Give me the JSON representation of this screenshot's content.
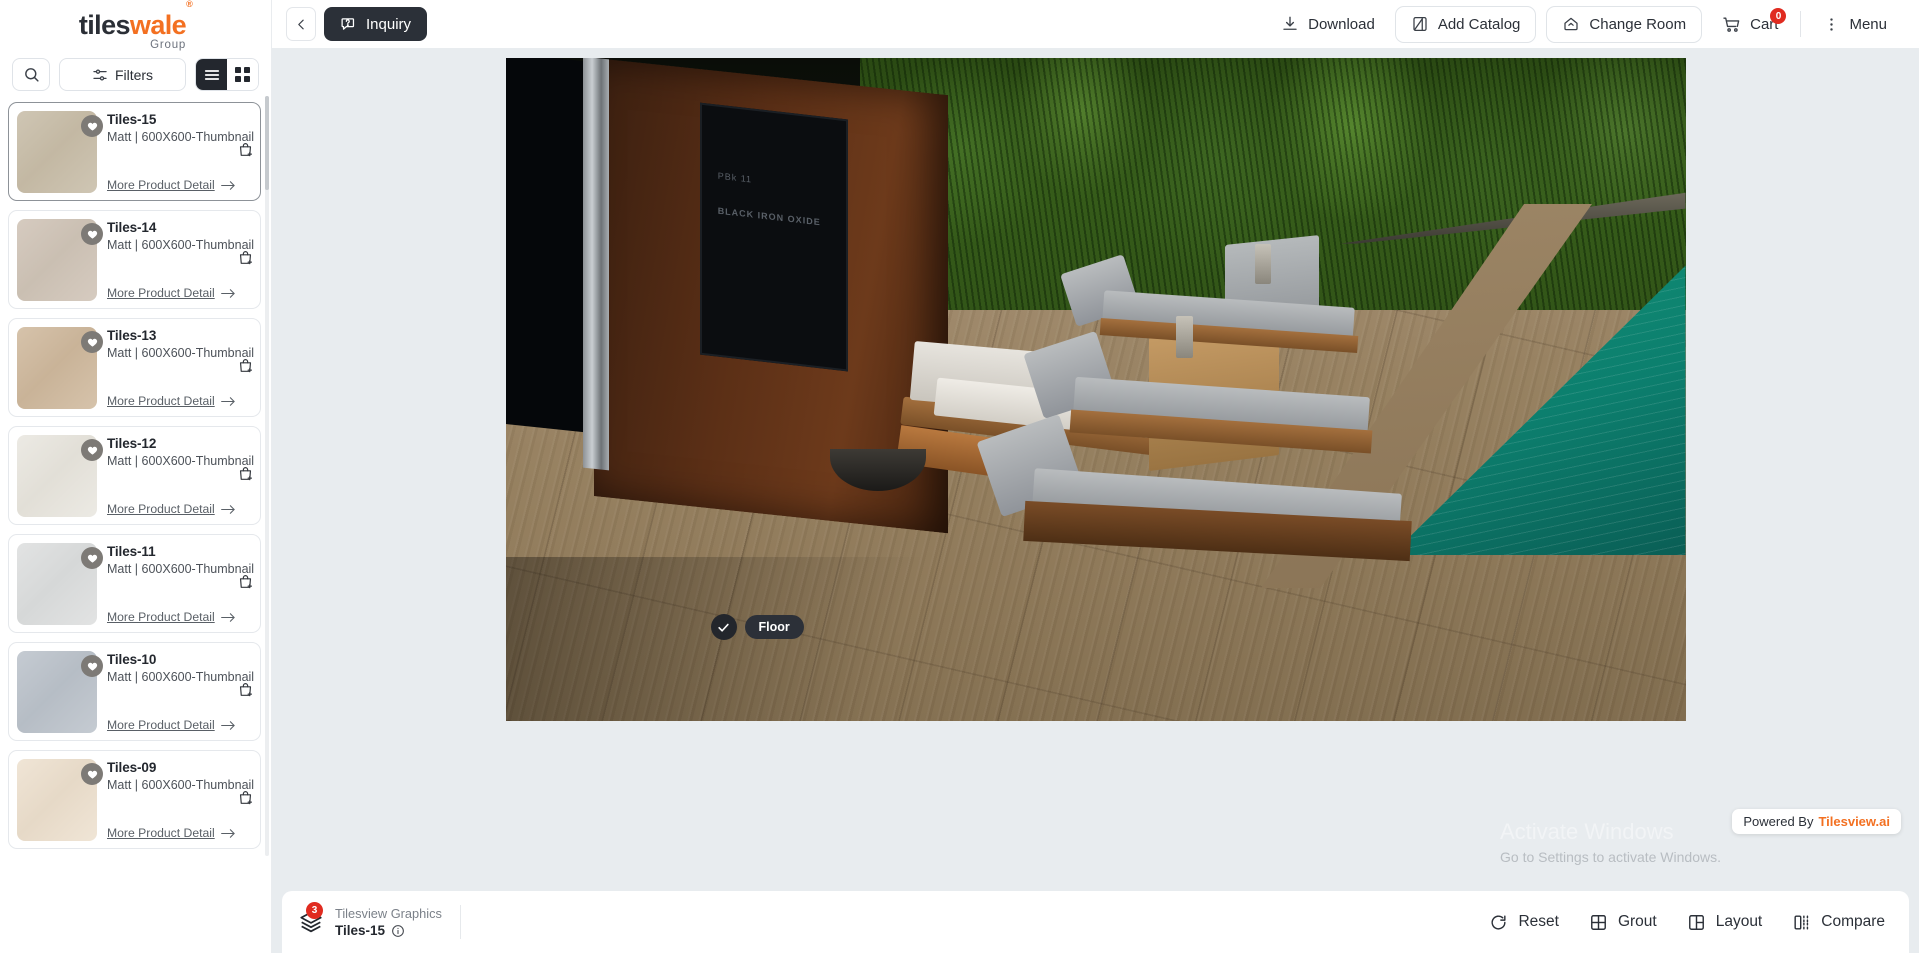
{
  "brand": {
    "name_part1": "tiles",
    "name_part2": "wale",
    "registered": "®",
    "subtitle": "Group"
  },
  "sidebar": {
    "search_icon": "search-icon",
    "filters_label": "Filters",
    "view_list_icon": "list-view-icon",
    "view_grid_icon": "grid-view-icon",
    "more_detail_label": "More Product Detail",
    "tiles": [
      {
        "name": "Tiles-15",
        "meta": "Matt | 600X600-Thumbnail",
        "color": "#cfc6b4",
        "color2": "#c3b8a3",
        "selected": true
      },
      {
        "name": "Tiles-14",
        "meta": "Matt | 600X600-Thumbnail",
        "color": "#d6cbc0",
        "color2": "#cabfb2",
        "selected": false
      },
      {
        "name": "Tiles-13",
        "meta": "Matt | 600X600-Thumbnail",
        "color": "#d6c3ab",
        "color2": "#c9b398",
        "selected": false
      },
      {
        "name": "Tiles-12",
        "meta": "Matt | 600X600-Thumbnail",
        "color": "#eceae4",
        "color2": "#e2dfd7",
        "selected": false
      },
      {
        "name": "Tiles-11",
        "meta": "Matt | 600X600-Thumbnail",
        "color": "#e2e3e3",
        "color2": "#d6d8d8",
        "selected": false
      },
      {
        "name": "Tiles-10",
        "meta": "Matt | 600X600-Thumbnail",
        "color": "#c5cbd2",
        "color2": "#b6bdc5",
        "selected": false
      },
      {
        "name": "Tiles-09",
        "meta": "Matt | 600X600-Thumbnail",
        "color": "#f0e5d6",
        "color2": "#e6d9c7",
        "selected": false
      }
    ]
  },
  "topbar": {
    "back_icon": "chevron-left-icon",
    "inquiry_label": "Inquiry",
    "inquiry_icon": "inquiry-chat-icon",
    "download_label": "Download",
    "download_icon": "download-icon",
    "add_catalog_label": "Add Catalog",
    "add_catalog_icon": "catalog-icon",
    "change_room_label": "Change Room",
    "change_room_icon": "home-icon",
    "cart_label": "Cart",
    "cart_icon": "cart-icon",
    "cart_count": "0",
    "menu_label": "Menu",
    "menu_icon": "more-vertical-icon"
  },
  "canvas": {
    "scene_wall_text_line1": "PBk 11",
    "scene_wall_text_line2": "BLACK IRON OXIDE",
    "surface_chip_label": "Floor",
    "surface_chip_check": "check-icon",
    "watermark_prefix": "Powered By",
    "watermark_brand": "Tilesview.ai",
    "windows_activate_line1": "Activate Windows",
    "windows_activate_line2": "Go to Settings to activate Windows."
  },
  "bottombar": {
    "layers_icon": "layers-icon",
    "layers_count": "3",
    "layers_title": "Tilesview Graphics",
    "selected_tile": "Tiles-15",
    "info_icon": "info-icon",
    "actions": [
      {
        "label": "Reset",
        "icon": "reset-icon"
      },
      {
        "label": "Grout",
        "icon": "grout-icon"
      },
      {
        "label": "Layout",
        "icon": "layout-icon"
      },
      {
        "label": "Compare",
        "icon": "compare-icon"
      }
    ]
  },
  "colors": {
    "accent": "#f37021",
    "dark": "#2b3038",
    "badge_red": "#e02b20",
    "panel_bg": "#e8ecef"
  }
}
